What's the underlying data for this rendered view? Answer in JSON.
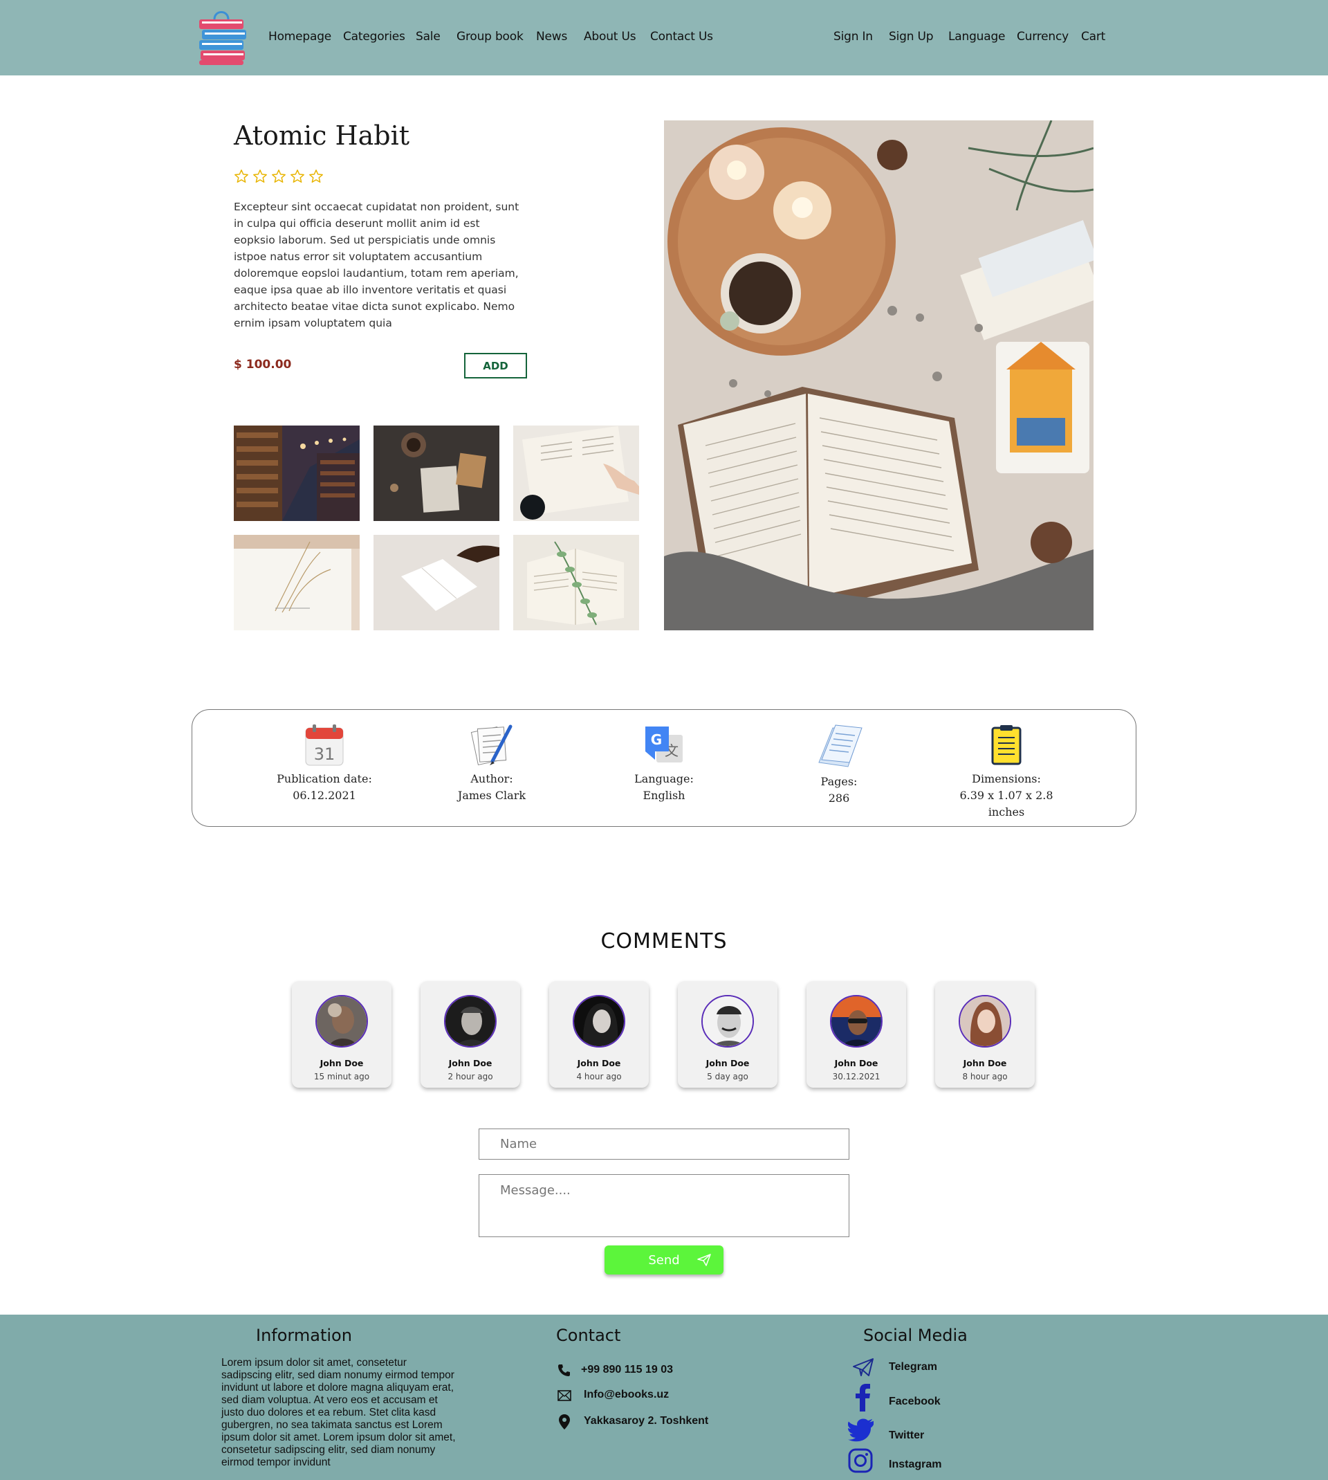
{
  "header": {
    "nav_left": [
      "Homepage",
      "Categories",
      "Sale",
      "Group book",
      "News",
      "About Us",
      "Contact Us"
    ],
    "nav_right": [
      "Sign In",
      "Sign Up",
      "Language",
      "Currency",
      "Cart"
    ],
    "logo_icon": "books-bag-logo-icon",
    "background": "#8fb6b5"
  },
  "product": {
    "title": "Atomic Habit",
    "rating": 0,
    "rating_max": 5,
    "description": "Excepteur sint occaecat cupidatat non proident, sunt in culpa qui officia deserunt mollit anim id est eopksio laborum. Sed ut perspiciatis unde omnis istpoe natus error sit voluptatem accusantium doloremque eopsloi laudantium, totam rem aperiam, eaque ipsa quae ab illo inventore veritatis et quasi architecto beatae vitae dicta sunot explicabo. Nemo ernim ipsam voluptatem quia",
    "price": "$ 100.00",
    "add_label": "ADD",
    "price_color": "#8c2a1e",
    "add_color": "#14643a"
  },
  "details": [
    {
      "icon": "calendar-icon",
      "label": "Publication date:",
      "value": "06.12.2021",
      "cal_day": "31"
    },
    {
      "icon": "document-pen-icon",
      "label": "Author:",
      "value": "James Clark"
    },
    {
      "icon": "translate-icon",
      "label": "Language:",
      "value": "English"
    },
    {
      "icon": "pages-icon",
      "label": "Pages:",
      "value": "286"
    },
    {
      "icon": "clipboard-icon",
      "label": "Dimensions:",
      "value": "6.39 x 1.07 x 2.8 inches"
    }
  ],
  "comments": {
    "title": "COMMENTS",
    "items": [
      {
        "name": "John Doe",
        "time": "15 minut ago"
      },
      {
        "name": "John Doe",
        "time": "2 hour ago"
      },
      {
        "name": "John Doe",
        "time": "4 hour ago"
      },
      {
        "name": "John Doe",
        "time": "5 day ago"
      },
      {
        "name": "John Doe",
        "time": "30.12.2021"
      },
      {
        "name": "John Doe",
        "time": "8 hour ago"
      }
    ],
    "form": {
      "name_placeholder": "Name",
      "message_placeholder": "Message....",
      "send_label": "Send",
      "send_color": "#5cf53b"
    }
  },
  "footer": {
    "information_title": "Information",
    "information_text": "Lorem ipsum dolor sit amet, consetetur sadipscing elitr, sed diam nonumy eirmod tempor invidunt ut labore et dolore magna aliquyam erat, sed diam voluptua. At vero eos et accusam et justo duo dolores et ea rebum. Stet clita kasd gubergren, no sea takimata sanctus est Lorem ipsum dolor sit amet. Lorem ipsum dolor sit amet, consetetur sadipscing elitr, sed diam nonumy eirmod tempor invidunt",
    "contact_title": "Contact",
    "contact": [
      {
        "icon": "phone-icon",
        "text": "+99 890 115 19 03"
      },
      {
        "icon": "mail-icon",
        "text": "Info@ebooks.uz"
      },
      {
        "icon": "location-pin-icon",
        "text": "Yakkasaroy 2. Toshkent"
      }
    ],
    "social_title": "Social Media",
    "social": [
      {
        "icon": "telegram-icon",
        "text": "Telegram"
      },
      {
        "icon": "facebook-icon",
        "text": "Facebook"
      },
      {
        "icon": "twitter-icon",
        "text": "Twitter"
      },
      {
        "icon": "instagram-icon",
        "text": "Instagram"
      }
    ],
    "background": "#80abaa"
  }
}
